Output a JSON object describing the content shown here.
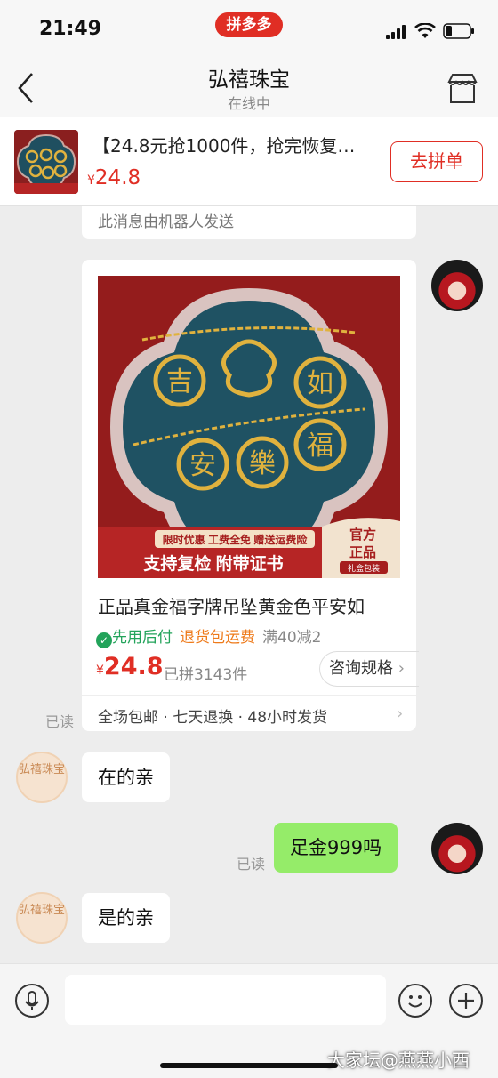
{
  "status_bar": {
    "time": "21:49",
    "app_badge": "拼多多"
  },
  "nav": {
    "title": "弘禧珠宝",
    "subtitle": "在线中"
  },
  "product_bar": {
    "title": "【24.8元抢1000件，抢完恢复…",
    "currency": "¥",
    "price": "24.8",
    "button": "去拼单"
  },
  "robot_note": "此消息由机器人发送",
  "product_card": {
    "title": "正品真金福字牌吊坠黄金色平安如",
    "tag_pay": "先用后付",
    "tag_return": "退货包运费",
    "tag_discount": "满40减2",
    "currency": "¥",
    "price": "24.8",
    "sold": "已拼3143件",
    "consult": "咨询规格",
    "service": "全场包邮 · 七天退换 · 48小时发货",
    "image": {
      "promo_small": "限时优惠   工费全免   赠送运费险",
      "promo_big": "支持复检 附带证书",
      "badge_top": "官方",
      "badge_mid": "正品",
      "badge_sub": "礼盒包装",
      "pendant_chars": [
        "吉",
        "如",
        "安",
        "樂",
        "福"
      ],
      "colors": {
        "frame": "#941c1c",
        "inner": "#1f5263",
        "gold": "#e0b23e"
      }
    }
  },
  "shop_avatar_text": "弘禧珠宝",
  "messages": [
    {
      "from": "shop",
      "text": "在的亲"
    },
    {
      "from": "me",
      "text": "足金999吗",
      "status": "已读"
    },
    {
      "from": "shop",
      "text": "是的亲"
    }
  ],
  "card_read_status": "已读",
  "watermark": "大家坛@燕燕小西",
  "colors": {
    "accent": "#e02e24",
    "bubble_out": "#95ec69",
    "pay_green": "#22a35a",
    "return_orange": "#ee7a1a"
  }
}
